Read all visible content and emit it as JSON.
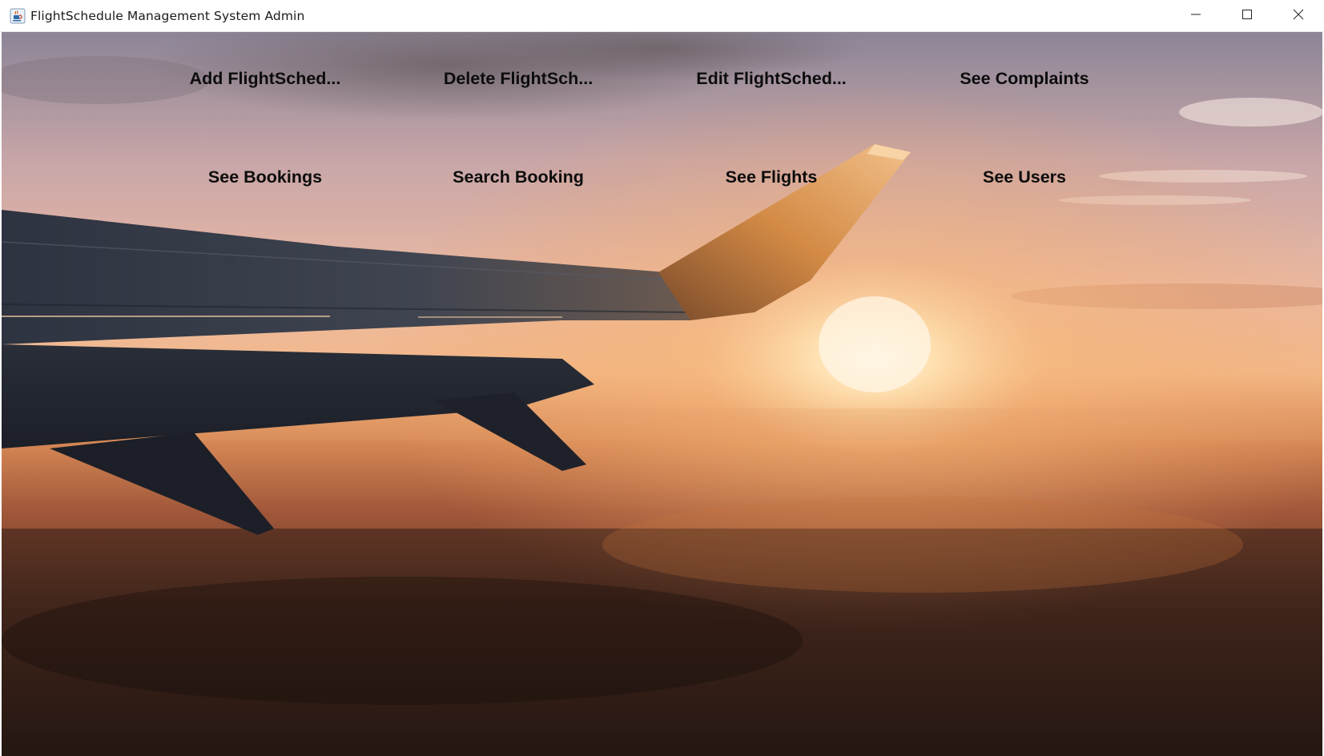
{
  "window": {
    "title": "FlightSchedule Management System Admin",
    "icon": "java-cup-icon",
    "controls": [
      "minimize-icon",
      "maximize-icon",
      "close-icon"
    ]
  },
  "menu": {
    "row1": [
      {
        "label": "Add FlightSched..."
      },
      {
        "label": "Delete FlightSch..."
      },
      {
        "label": "Edit FlightSched..."
      },
      {
        "label": "See Complaints"
      }
    ],
    "row2": [
      {
        "label": "See Bookings"
      },
      {
        "label": "Search Booking"
      },
      {
        "label": "See Flights"
      },
      {
        "label": "See Users"
      }
    ]
  },
  "background": {
    "description_icon": "airplane-wing-sunset-image",
    "colors": {
      "sky_top": "#9a8fa0",
      "sky_glow": "#f6c79a",
      "sun": "#fff1d8",
      "ground": "#2a1a14",
      "wing": "#3b3f4a"
    }
  }
}
